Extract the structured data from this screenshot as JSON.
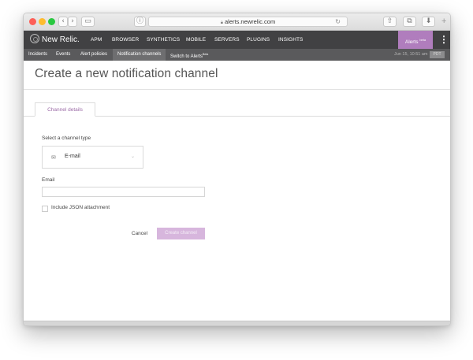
{
  "browser": {
    "url": "alerts.newrelic.com",
    "traffic_colors": {
      "close": "#fd5f57",
      "minimize": "#febc2e",
      "zoom": "#29c840"
    },
    "icons": [
      "back-icon",
      "forward-icon",
      "sidebar-icon",
      "info-icon",
      "lock-icon",
      "reload-icon",
      "share-icon",
      "tabs-icon",
      "download-icon",
      "plus-icon"
    ]
  },
  "nav": {
    "logo": "New Relic.",
    "items": [
      "APM",
      "BROWSER",
      "SYNTHETICS",
      "MOBILE",
      "SERVERS",
      "PLUGINS",
      "INSIGHTS"
    ],
    "alerts_label": "Alerts",
    "alerts_sup": "beta",
    "brand_color": "#b07dbd",
    "bar_color": "#414143"
  },
  "subnav": {
    "items": [
      "Incidents",
      "Events",
      "Alert policies",
      "Notification channels"
    ],
    "switch_label": "Switch to Alerts",
    "switch_sup": "Beta",
    "active": "Notification channels",
    "timestamp": "Jun 15, 10:51 am",
    "timezone": "PDT"
  },
  "page": {
    "title": "Create a new notification channel",
    "tab_label": "Channel details",
    "channel_type_label": "Select a channel type",
    "channel_type_value": "E-mail",
    "email_label": "Email",
    "email_value": "",
    "json_attachment_label": "Include JSON attachment",
    "json_attachment_checked": false,
    "cancel_label": "Cancel",
    "create_label": "Create channel"
  }
}
